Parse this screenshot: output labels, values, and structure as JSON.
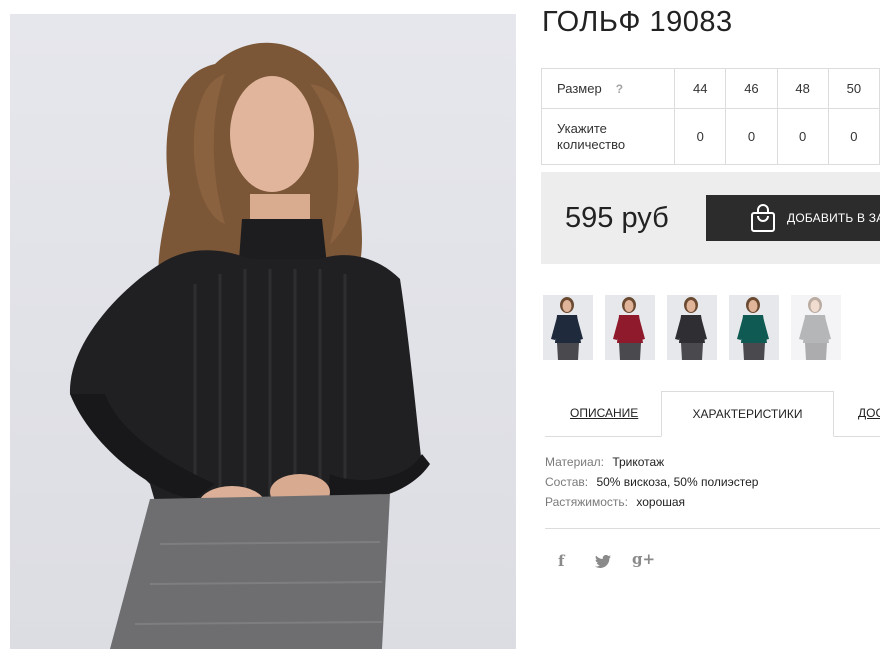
{
  "product": {
    "title": "ГОЛЬФ 19083"
  },
  "size_table": {
    "size_label": "Размер",
    "help_symbol": "?",
    "quantity_label": "Укажите количество",
    "sizes": [
      "44",
      "46",
      "48",
      "50"
    ],
    "quantities": [
      "0",
      "0",
      "0",
      "0"
    ]
  },
  "purchase": {
    "price": "595 руб",
    "add_to_cart_label": "ДОБАВИТЬ В ЗАКАЗ",
    "icon": "shopping-bag-icon"
  },
  "color_variants": [
    {
      "color": "#1f2a3d",
      "selected": false
    },
    {
      "color": "#8e1a2c",
      "selected": false
    },
    {
      "color": "#2f2f33",
      "selected": false
    },
    {
      "color": "#0f5a52",
      "selected": false
    },
    {
      "color": "#5d5f64",
      "selected": true
    }
  ],
  "tabs": {
    "description": "ОПИСАНИЕ",
    "characteristics": "ХАРАКТЕРИСТИКИ",
    "delivery": "ДОСТАВКА"
  },
  "characteristics": [
    {
      "label": "Материал:",
      "value": "Трикотаж"
    },
    {
      "label": "Состав:",
      "value": "50% вискоза, 50% полиэстер"
    },
    {
      "label": "Растяжимость:",
      "value": "хорошая"
    }
  ],
  "social": {
    "facebook": "f",
    "twitter": "twitter-bird-icon",
    "google_plus": "g+"
  }
}
